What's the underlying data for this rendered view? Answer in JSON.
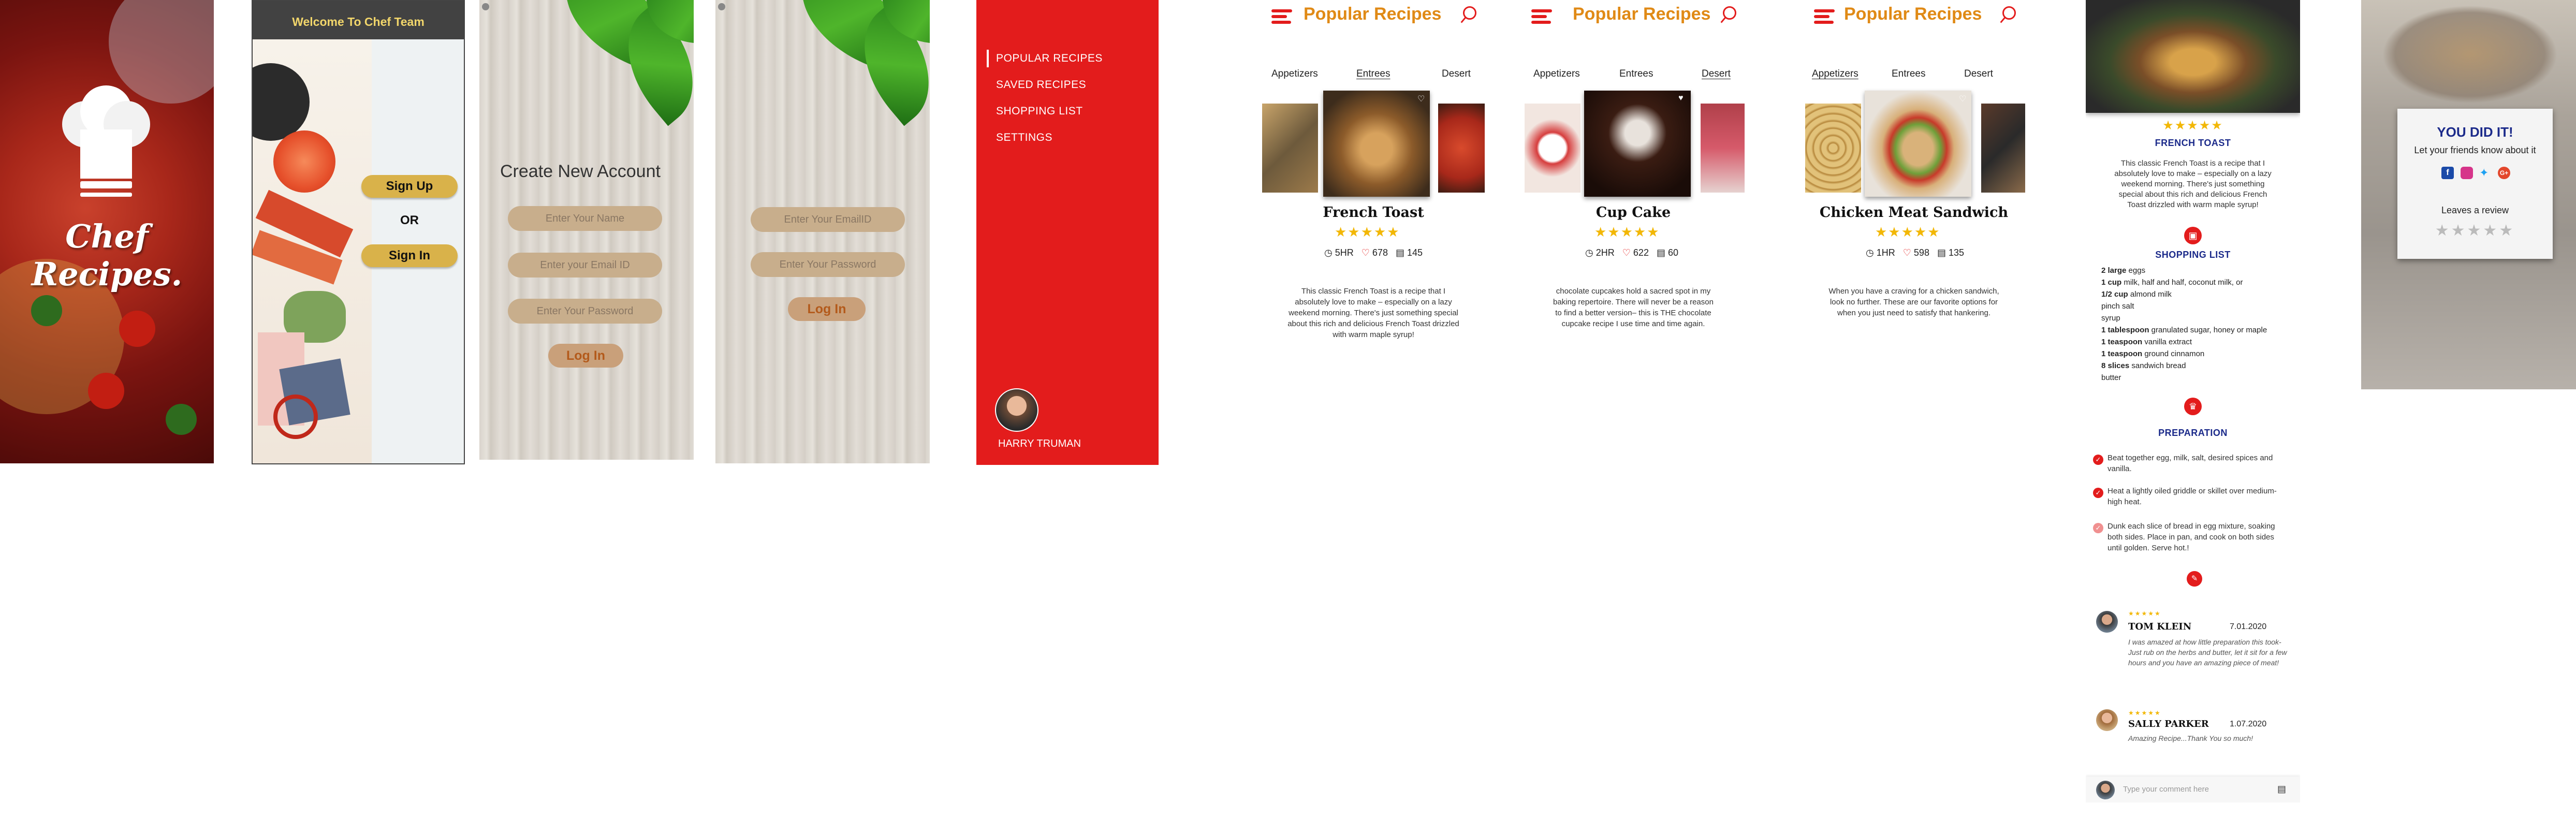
{
  "splash": {
    "title": "Chef Recipes."
  },
  "welcome": {
    "header": "Welcome To Chef Team",
    "signup": "Sign Up",
    "or": "OR",
    "signin": "Sign In"
  },
  "create": {
    "title": "Create New Account",
    "name_ph": "Enter Your Name",
    "email_ph": "Enter your Email ID",
    "pass_ph": "Enter Your Password",
    "login": "Log In"
  },
  "login": {
    "email_ph": "Enter Your EmailID",
    "pass_ph": "Enter Your Password",
    "login": "Log In"
  },
  "menu": {
    "items": [
      "POPULAR RECIPES",
      "SAVED RECIPES",
      "SHOPPING LIST",
      "SETTINGS"
    ],
    "user": "HARRY TRUMAN"
  },
  "list_header": "Popular Recipes",
  "tabs": [
    "Appetizers",
    "Entrees",
    "Desert"
  ],
  "recipes": [
    {
      "title": "French Toast",
      "stars": "★★★★★",
      "time": "5HR",
      "likes": "678",
      "comments": "145",
      "desc": "This classic French Toast is a recipe that I absolutely love to make – especially on a lazy weekend morning. There's just something special about this rich and delicious French Toast drizzled with warm maple syrup!"
    },
    {
      "title": "Cup Cake",
      "stars": "★★★★★",
      "time": "2HR",
      "likes": "622",
      "comments": "60",
      "desc": "chocolate cupcakes hold a sacred spot in my baking repertoire. There will never be a reason to find a better version– this is THE chocolate cupcake recipe I use time and time again."
    },
    {
      "title": "Chicken Meat Sandwich",
      "stars": "★★★★★",
      "time": "1HR",
      "likes": "598",
      "comments": "135",
      "desc": "When you have a craving for a chicken sandwich, look no further. These are our favorite options for when you just need to satisfy that hankering."
    }
  ],
  "detail": {
    "stars": "★★★★★",
    "title": "FRENCH TOAST",
    "desc": "This classic French Toast is a recipe that I absolutely love to make – especially on a lazy weekend morning. There's just something special about this rich and delicious French Toast drizzled with warm maple syrup!",
    "shopping_title": "SHOPPING LIST",
    "ingredients": [
      {
        "qty": "2 large",
        "item": " eggs"
      },
      {
        "qty": "1 cup",
        "item": " milk, half and half, coconut milk, or"
      },
      {
        "qty": "1/2 cup",
        "item": " almond milk"
      },
      {
        "qty": "",
        "item": "pinch salt"
      },
      {
        "qty": "",
        "item": "syrup"
      },
      {
        "qty": "1 tablespoon",
        "item": " granulated sugar, honey or maple"
      },
      {
        "qty": "1 teaspoon",
        "item": " vanilla extract"
      },
      {
        "qty": "1 teaspoon",
        "item": " ground cinnamon"
      },
      {
        "qty": "8 slices",
        "item": " sandwich bread"
      },
      {
        "qty": "",
        "item": "butter"
      }
    ],
    "prep_title": "PREPARATION",
    "steps": [
      "Beat together egg, milk, salt, desired spices and vanilla.",
      "Heat a lightly oiled griddle or skillet over medium-high heat.",
      "Dunk each slice of bread in egg mixture, soaking both sides. Place in pan, and cook on both sides until golden. Serve hot.!"
    ],
    "reviews": [
      {
        "name": "TOM KLEIN",
        "date": "7.01.2020",
        "stars": "★★★★★",
        "text": "I was amazed at how little preparation this took-Just rub on the herbs and butter, let it sit for a few hours and you have an amazing piece of meat!"
      },
      {
        "name": "SALLY PARKER",
        "date": "1.07.2020",
        "stars": "★★★★★",
        "text": "Amazing Recipe...Thank You so much!"
      }
    ],
    "comment_ph": "Type your comment here"
  },
  "done": {
    "title": "YOU DID IT!",
    "subtitle": "Let your friends know about it",
    "review": "Leaves a review",
    "stars": "★★★★★"
  },
  "colors": {
    "red": "#e31c1c",
    "orange": "#e08a16",
    "gold": "#d9b24a",
    "navy": "#1b2a8a"
  }
}
